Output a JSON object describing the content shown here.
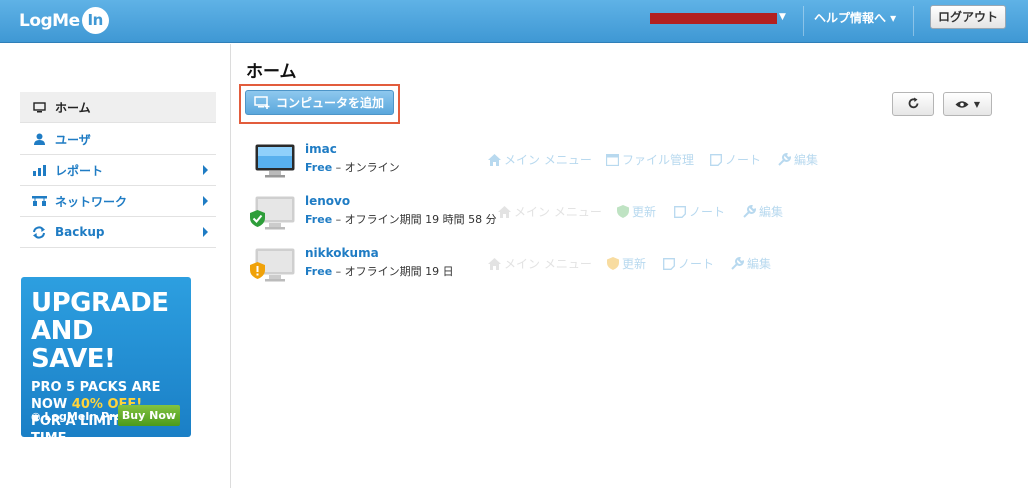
{
  "header": {
    "logo_text": "LogMe",
    "logo_circle_text": "In",
    "help_menu_label": "ヘルプ情報へ ▾",
    "logout_label": "ログアウト"
  },
  "sidebar": {
    "items": [
      {
        "label": "ホーム"
      },
      {
        "label": "ユーザ"
      },
      {
        "label": "レポート"
      },
      {
        "label": "ネットワーク"
      },
      {
        "label": "Backup"
      }
    ]
  },
  "promo": {
    "line1": "UPGRADE",
    "line2": "AND SAVE!",
    "line3": "PRO 5 PACKS ARE",
    "line4_pre": "NOW ",
    "line4_hl": "40% OFF!",
    "line5": "FOR A LIMITED TIME.",
    "brand": "◉ LogMeIn Pro",
    "buy_label": "Buy Now"
  },
  "main": {
    "title": "ホーム",
    "add_computer_label": "コンピュータを追加",
    "computers": [
      {
        "name": "imac",
        "plan": "Free",
        "status": " – オンライン",
        "actions": [
          "メイン メニュー",
          "ファイル管理",
          "ノート",
          "編集"
        ]
      },
      {
        "name": "lenovo",
        "plan": "Free",
        "status": " – オフライン期間 19 時間 58 分",
        "actions": [
          "メイン メニュー",
          "更新",
          "ノート",
          "編集"
        ]
      },
      {
        "name": "nikkokuma",
        "plan": "Free",
        "status": " – オフライン期間 19 日",
        "actions": [
          "メイン メニュー",
          "更新",
          "ノート",
          "編集"
        ]
      }
    ]
  },
  "colors": {
    "accent": "#1f7cc4",
    "topbar": "#4aa3dc",
    "highlight_border": "#e25c3c",
    "ok_badge": "#2e9e3a",
    "warn_badge": "#f0a20a"
  }
}
